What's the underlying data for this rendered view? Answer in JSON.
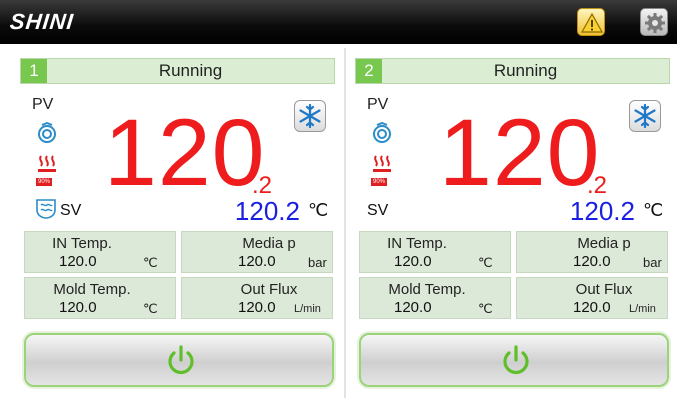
{
  "header": {
    "brand": "SHINI",
    "warning_icon": "warning-icon",
    "settings_icon": "gear-icon"
  },
  "colors": {
    "pv": "#ee1c1c",
    "sv": "#1a20e0",
    "unit_badge": "#78c850",
    "status_bg": "#dbeed4",
    "tile_bg": "#dde9d8"
  },
  "units": [
    {
      "number": "1",
      "status": "Running",
      "pv_label": "PV",
      "pv_int": "120",
      "pv_dec": ".2",
      "heater_percent": "90%",
      "sv_label": "SV",
      "sv_value": "120.2",
      "sv_unit": "℃",
      "tiles": {
        "in_temp": {
          "label": "IN  Temp.",
          "value": "120.0",
          "unit": "℃"
        },
        "media_p": {
          "label": "Media p",
          "value": "120.0",
          "unit": "bar"
        },
        "mold_temp": {
          "label": "Mold  Temp.",
          "value": "120.0",
          "unit": "℃"
        },
        "out_flux": {
          "label": "Out Flux",
          "value": "120.0",
          "unit": "L/min"
        }
      }
    },
    {
      "number": "2",
      "status": "Running",
      "pv_label": "PV",
      "pv_int": "120",
      "pv_dec": ".2",
      "heater_percent": "90%",
      "sv_label": "SV",
      "sv_value": "120.2",
      "sv_unit": "℃",
      "tiles": {
        "in_temp": {
          "label": "IN  Temp.",
          "value": "120.0",
          "unit": "℃"
        },
        "media_p": {
          "label": "Media p",
          "value": "120.0",
          "unit": "bar"
        },
        "mold_temp": {
          "label": "Mold  Temp.",
          "value": "120.0",
          "unit": "℃"
        },
        "out_flux": {
          "label": "Out Flux",
          "value": "120.0",
          "unit": "L/min"
        }
      }
    }
  ]
}
